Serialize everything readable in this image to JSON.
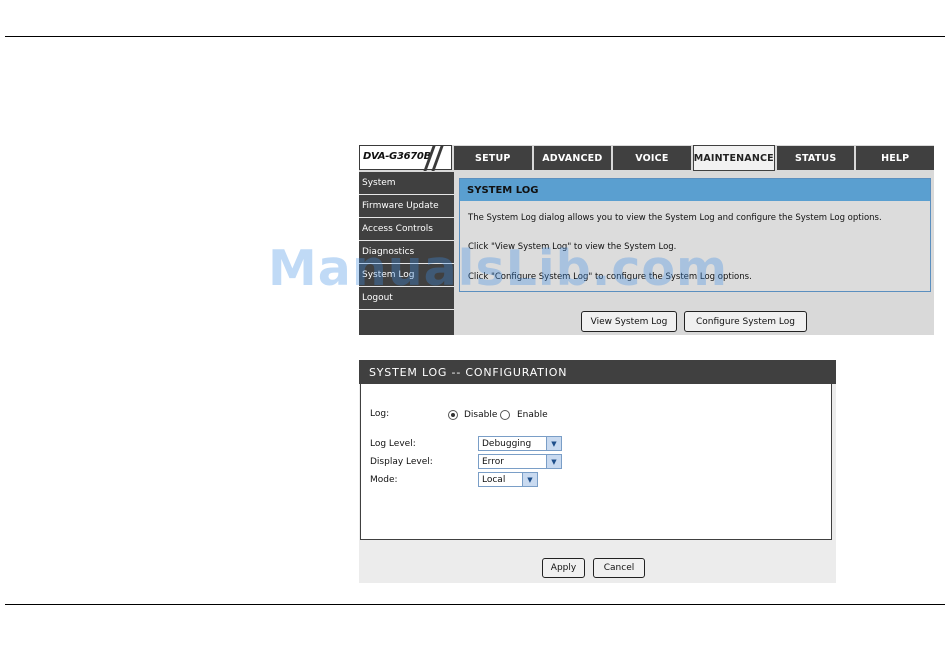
{
  "router": {
    "model": "DVA-G3670B",
    "tabs": [
      "SETUP",
      "ADVANCED",
      "VOICE",
      "MAINTENANCE",
      "STATUS",
      "HELP"
    ],
    "active_tab": "MAINTENANCE",
    "sidebar": [
      "System",
      "Firmware Update",
      "Access Controls",
      "Diagnostics",
      "System Log",
      "Logout"
    ],
    "panel": {
      "title": "SYSTEM LOG",
      "line1": "The System Log dialog allows you to view the System Log and configure the System Log options.",
      "line2": "Click \"View System Log\" to view the System Log.",
      "line3": "Click \"Configure System Log\" to configure the System Log options."
    },
    "buttons": {
      "view": "View System Log",
      "configure": "Configure System Log"
    }
  },
  "config": {
    "title": "SYSTEM LOG -- CONFIGURATION",
    "log_label": "Log:",
    "log_options": [
      "Disable",
      "Enable"
    ],
    "log_selected": "Disable",
    "log_level_label": "Log Level:",
    "log_level_value": "Debugging",
    "display_level_label": "Display Level:",
    "display_level_value": "Error",
    "mode_label": "Mode:",
    "mode_value": "Local",
    "apply": "Apply",
    "cancel": "Cancel"
  },
  "watermark": "ManualsLib.com"
}
